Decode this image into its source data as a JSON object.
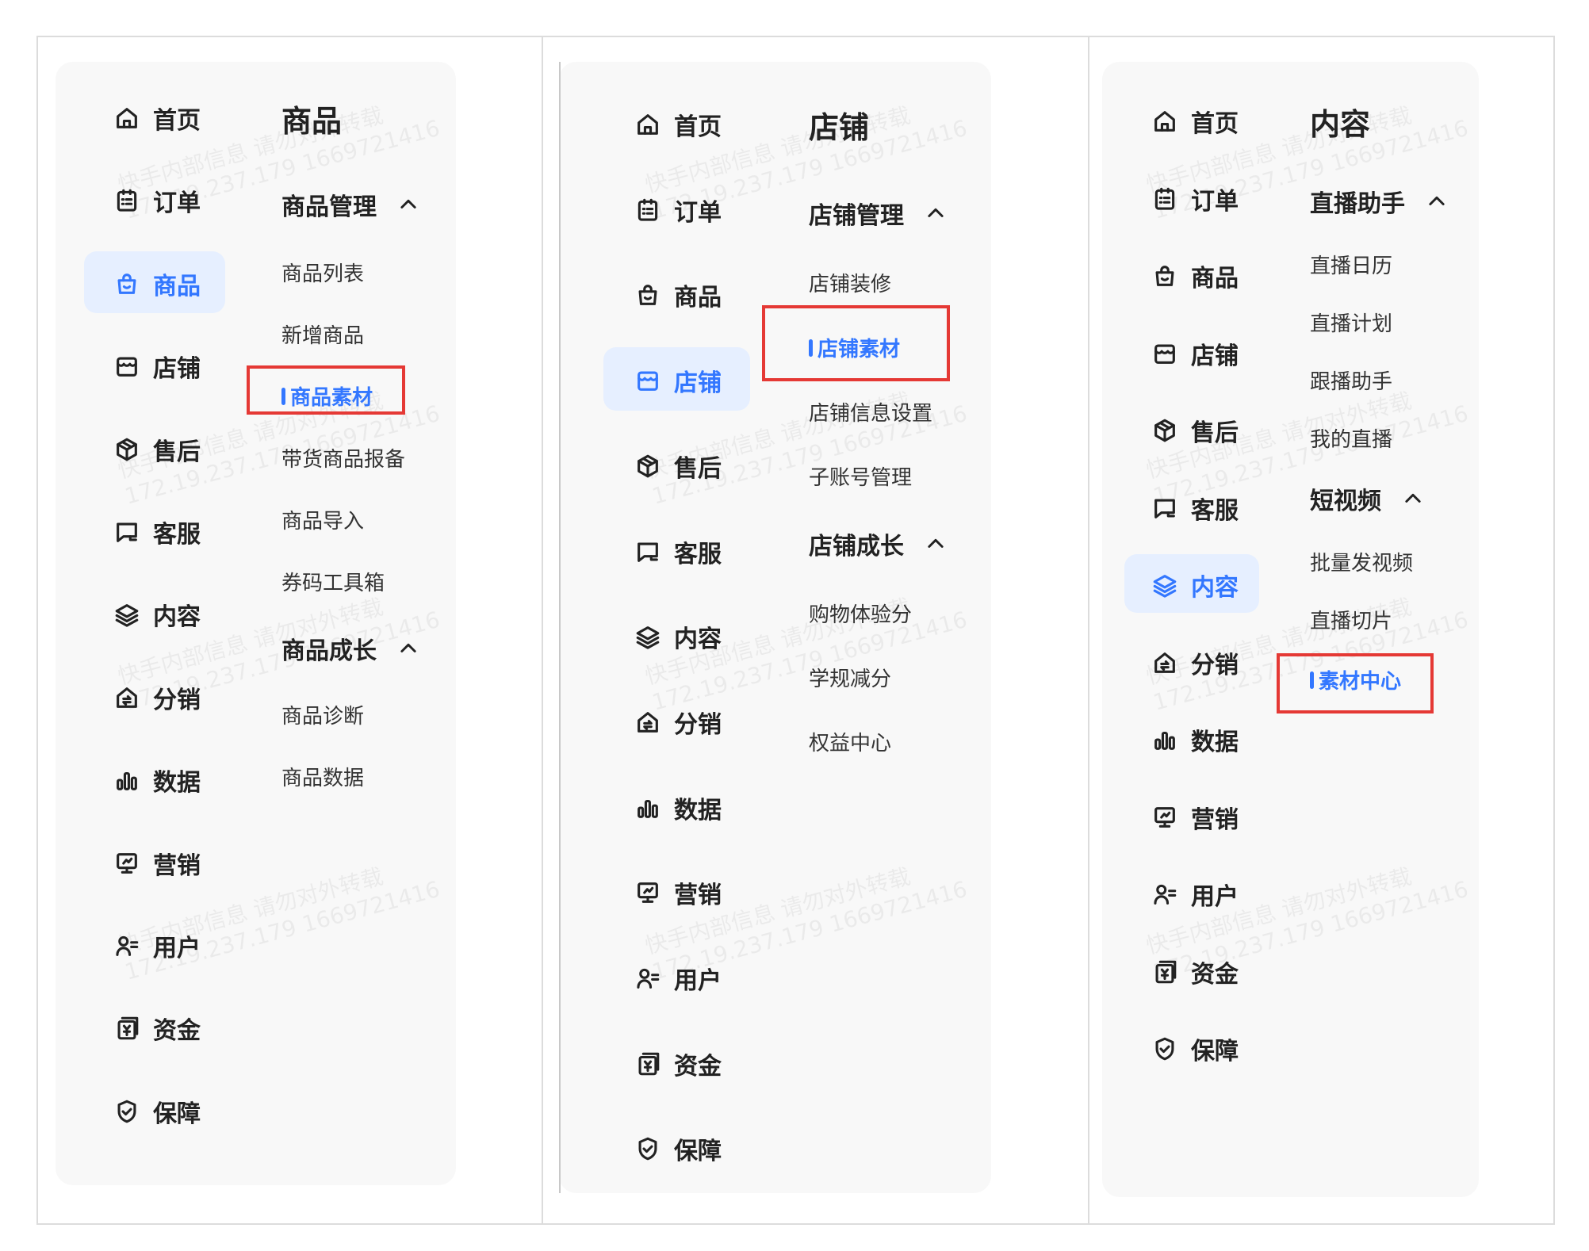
{
  "accent_color": "#3377ff",
  "highlight_color": "#e53935",
  "watermark": [
    "快手内部信息 请勿对外转载",
    "172.19.237.179 1669721416"
  ],
  "nav_items": [
    {
      "key": "home",
      "label": "首页",
      "icon": "home-icon"
    },
    {
      "key": "order",
      "label": "订单",
      "icon": "order-icon"
    },
    {
      "key": "product",
      "label": "商品",
      "icon": "bag-icon"
    },
    {
      "key": "shop",
      "label": "店铺",
      "icon": "shop-icon"
    },
    {
      "key": "after_sale",
      "label": "售后",
      "icon": "box-icon"
    },
    {
      "key": "service",
      "label": "客服",
      "icon": "chat-icon"
    },
    {
      "key": "content",
      "label": "内容",
      "icon": "layers-icon"
    },
    {
      "key": "distribution",
      "label": "分销",
      "icon": "distribution-icon"
    },
    {
      "key": "data",
      "label": "数据",
      "icon": "bar-chart-icon"
    },
    {
      "key": "marketing",
      "label": "营销",
      "icon": "marketing-icon"
    },
    {
      "key": "user",
      "label": "用户",
      "icon": "user-list-icon"
    },
    {
      "key": "fund",
      "label": "资金",
      "icon": "fund-icon"
    },
    {
      "key": "guarantee",
      "label": "保障",
      "icon": "shield-check-icon"
    }
  ],
  "panels": [
    {
      "active_nav": "商品",
      "title": "商品",
      "groups": [
        {
          "title": "商品管理",
          "icon": "chevron-up-icon",
          "items": [
            "商品列表",
            "新增商品",
            "商品素材",
            "带货商品报备",
            "商品导入",
            "券码工具箱"
          ],
          "active": "商品素材"
        },
        {
          "title": "商品成长",
          "icon": "chevron-up-icon",
          "items": [
            "商品诊断",
            "商品数据"
          ]
        }
      ]
    },
    {
      "active_nav": "店铺",
      "title": "店铺",
      "groups": [
        {
          "title": "店铺管理",
          "icon": "chevron-up-icon",
          "items": [
            "店铺装修",
            "店铺素材",
            "店铺信息设置",
            "子账号管理"
          ],
          "active": "店铺素材"
        },
        {
          "title": "店铺成长",
          "icon": "chevron-up-icon",
          "items": [
            "购物体验分",
            "学规减分",
            "权益中心"
          ]
        }
      ]
    },
    {
      "active_nav": "内容",
      "title": "内容",
      "groups": [
        {
          "title": "直播助手",
          "icon": "chevron-up-icon",
          "items": [
            "直播日历",
            "直播计划",
            "跟播助手",
            "我的直播"
          ]
        },
        {
          "title": "短视频",
          "icon": "chevron-up-icon",
          "items": [
            "批量发视频",
            "直播切片",
            "素材中心"
          ],
          "active": "素材中心"
        }
      ]
    }
  ]
}
